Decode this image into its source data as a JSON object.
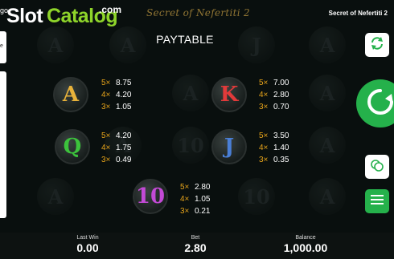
{
  "watermark": {
    "slot": "Slot",
    "catalog": "Catalog",
    "com": ".com"
  },
  "header": {
    "game_logo": "Secret of Nefertiti 2",
    "game_title": "Secret of Nefertiti 2",
    "page_title": "PAYTABLE",
    "left_top_char": "go",
    "left_panel_char": "e"
  },
  "paytable": [
    {
      "symbol": "A",
      "color": "#e8b23a",
      "pays": [
        {
          "mult": "5×",
          "value": "8.75"
        },
        {
          "mult": "4×",
          "value": "4.20"
        },
        {
          "mult": "3×",
          "value": "1.05"
        }
      ]
    },
    {
      "symbol": "K",
      "color": "#e23a3a",
      "pays": [
        {
          "mult": "5×",
          "value": "7.00"
        },
        {
          "mult": "4×",
          "value": "2.80"
        },
        {
          "mult": "3×",
          "value": "0.70"
        }
      ]
    },
    {
      "symbol": "Q",
      "color": "#3cc23c",
      "pays": [
        {
          "mult": "5×",
          "value": "4.20"
        },
        {
          "mult": "4×",
          "value": "1.75"
        },
        {
          "mult": "3×",
          "value": "0.49"
        }
      ]
    },
    {
      "symbol": "J",
      "color": "#4a7fd6",
      "pays": [
        {
          "mult": "5×",
          "value": "3.50"
        },
        {
          "mult": "4×",
          "value": "1.40"
        },
        {
          "mult": "3×",
          "value": "0.35"
        }
      ]
    },
    {
      "symbol": "10",
      "color": "#c34ad6",
      "pays": [
        {
          "mult": "5×",
          "value": "2.80"
        },
        {
          "mult": "4×",
          "value": "1.05"
        },
        {
          "mult": "3×",
          "value": "0.21"
        }
      ]
    }
  ],
  "bottom_bar": {
    "last_win_label": "Last Win",
    "last_win_value": "0.00",
    "bet_label": "Bet",
    "bet_value": "2.80",
    "balance_label": "Balance",
    "balance_value": "1,000.00"
  },
  "icons": {
    "autoplay": "autoplay-icon",
    "spin": "spin-icon",
    "settings": "coins-icon",
    "menu": "hamburger-menu-icon"
  },
  "colors": {
    "accent_green": "#25b14b",
    "multiplier_orange": "#e7a41a",
    "watermark_green": "#8ed42a"
  }
}
